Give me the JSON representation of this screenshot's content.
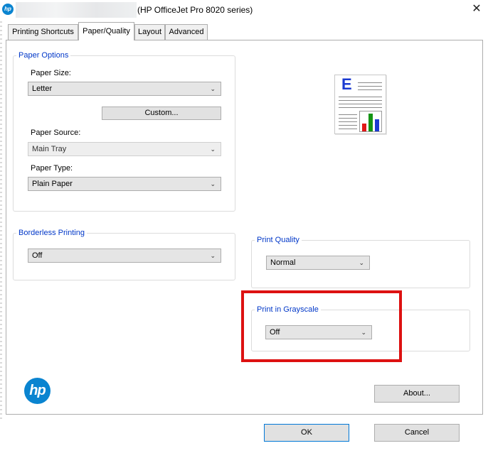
{
  "window": {
    "title": "(HP OfficeJet Pro 8020 series)",
    "close_glyph": "✕",
    "app_icon": "hp-logo-icon"
  },
  "tabs": [
    {
      "label": "Printing Shortcuts",
      "active": false
    },
    {
      "label": "Paper/Quality",
      "active": true
    },
    {
      "label": "Layout",
      "active": false
    },
    {
      "label": "Advanced",
      "active": false
    }
  ],
  "paper_options": {
    "legend": "Paper Options",
    "paper_size_label": "Paper Size:",
    "paper_size_value": "Letter",
    "custom_button": "Custom...",
    "paper_source_label": "Paper Source:",
    "paper_source_value": "Main Tray",
    "paper_type_label": "Paper Type:",
    "paper_type_value": "Plain Paper"
  },
  "borderless": {
    "legend": "Borderless Printing",
    "value": "Off"
  },
  "print_quality": {
    "legend": "Print Quality",
    "value": "Normal"
  },
  "grayscale": {
    "legend": "Print in Grayscale",
    "value": "Off"
  },
  "preview": {
    "letter": "E"
  },
  "about_button": "About...",
  "logo_text": "hp",
  "footer": {
    "ok": "OK",
    "cancel": "Cancel"
  },
  "colors": {
    "legend_blue": "#0037c8",
    "highlight_red": "#dd1111",
    "hp_blue": "#0a84d0"
  }
}
